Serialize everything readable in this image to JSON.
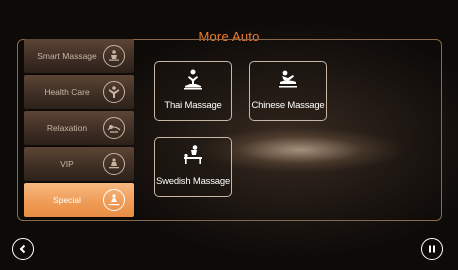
{
  "header": {
    "title": "More Auto"
  },
  "sidebar": {
    "items": [
      {
        "label": "Smart Massage",
        "icon": "smart-massage-icon",
        "active": false
      },
      {
        "label": "Health Care",
        "icon": "health-care-icon",
        "active": false
      },
      {
        "label": "Relaxation",
        "icon": "relaxation-icon",
        "active": false
      },
      {
        "label": "VIP",
        "icon": "vip-icon",
        "active": false
      },
      {
        "label": "Special",
        "icon": "special-icon",
        "active": true
      }
    ]
  },
  "programs": [
    {
      "label": "Thai Massage",
      "icon": "thai-massage-icon"
    },
    {
      "label": "Chinese Massage",
      "icon": "chinese-massage-icon"
    },
    {
      "label": "Swedish Massage",
      "icon": "swedish-massage-icon"
    }
  ],
  "footer": {
    "back_icon": "back-icon",
    "pause_icon": "pause-icon"
  },
  "colors": {
    "accent": "#f07a2e",
    "active_tab": "#f2a462",
    "border": "#c8b6a6"
  }
}
